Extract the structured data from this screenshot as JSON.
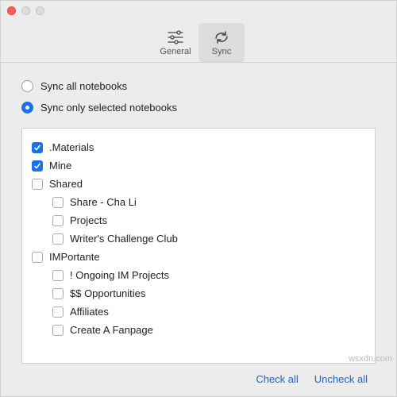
{
  "toolbar": {
    "general": "General",
    "sync": "Sync"
  },
  "sync_options": {
    "all": "Sync all notebooks",
    "selected": "Sync only selected notebooks"
  },
  "notebooks": {
    "materials": ".Materials",
    "mine": "Mine",
    "shared": "Shared",
    "shared_children": {
      "cha_li": "Share - Cha Li",
      "projects": "Projects",
      "writers": "Writer's Challenge Club"
    },
    "importante": "IMPortante",
    "importante_children": {
      "ongoing": "! Ongoing IM Projects",
      "opportunities": "$$ Opportunities",
      "affiliates": "Affiliates",
      "fanpage": "Create A Fanpage"
    }
  },
  "footer": {
    "check_all": "Check all",
    "uncheck_all": "Uncheck all"
  },
  "watermark": "wsxdn.com"
}
